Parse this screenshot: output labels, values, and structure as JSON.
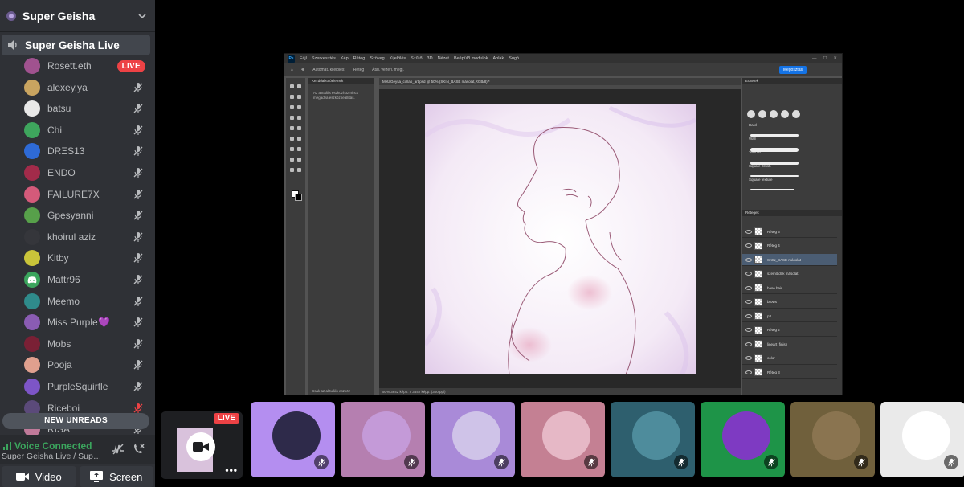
{
  "server": {
    "name": "Super Geisha"
  },
  "channel": {
    "name": "Super Geisha Live"
  },
  "users": [
    {
      "name": "Rosett.eth",
      "live": true,
      "color": "#a0528f"
    },
    {
      "name": "alexey.ya",
      "color": "#c9a460"
    },
    {
      "name": "batsu",
      "color": "#e8e8e8"
    },
    {
      "name": "Chi",
      "color": "#3ea55d"
    },
    {
      "name": "DRΞS13",
      "color": "#2e6ad6"
    },
    {
      "name": "ENDO",
      "color": "#a22b4a"
    },
    {
      "name": "FAILURE7X",
      "color": "#d45a7a"
    },
    {
      "name": "Gpesyanni",
      "color": "#57a04a"
    },
    {
      "name": "khoirul aziz",
      "color": "#35363b"
    },
    {
      "name": "Kitby",
      "color": "#c9c43a"
    },
    {
      "name": "Mattr96",
      "color": "#3ba55d",
      "discord": true
    },
    {
      "name": "Meemo",
      "color": "#2f8b8b"
    },
    {
      "name": "Miss Purple",
      "color": "#8a5cb3",
      "heart": "💜"
    },
    {
      "name": "Mobs",
      "color": "#7a2035"
    },
    {
      "name": "Pooja",
      "color": "#e0a08e"
    },
    {
      "name": "PurpleSquirtle",
      "color": "#7d55c7"
    },
    {
      "name": "Riceboi",
      "color": "#5b4a7a",
      "muted_red": true
    },
    {
      "name": "RISA",
      "color": "#c07a9a"
    }
  ],
  "new_unreads": "NEW UNREADS",
  "voice": {
    "status": "Voice Connected",
    "channel": "Super Geisha Live / Super Geisha"
  },
  "buttons": {
    "video": "Video",
    "screen": "Screen"
  },
  "stream": {
    "live_label": "LIVE"
  },
  "photoshop": {
    "logo": "Ps",
    "menu": [
      "Fájl",
      "Szerkesztés",
      "Kép",
      "Réteg",
      "Szöveg",
      "Kijelölés",
      "Szűrő",
      "3D",
      "Nézet",
      "Beépülő modulok",
      "Ablak",
      "Súgó"
    ],
    "options": [
      "Automat. kijelölés:",
      "Réteg",
      "Átal. vezérl. megj."
    ],
    "share": "Megosztás",
    "lib_tab": "Kezdőalkotóelemek",
    "lib_text": "Az aktuális eszközhöz nincs megadva eszközbeállítás.",
    "lib_bottom": "Csak az aktuális eszköz",
    "doc_tab": "MetaGeysa_collab_art.psd @ 50% (SKIN_BASE másolat,RGB/8) *",
    "status": "50%   3642 képp. x 3642 képp. (300 ppi)",
    "brushes_title": "Ecsetek",
    "brush_categories": [
      "Hard",
      "Wall",
      "Texture",
      "Square Brush",
      "Square texture"
    ],
    "layers_title": "Rétegek",
    "layers": [
      "Réteg 5",
      "Réteg 4",
      "SKIN_BASE másolat",
      "szemöldök másolat",
      "base hair",
      "brows",
      "p3",
      "Réteg 2",
      "lineart_finish",
      "color",
      "Réteg 3"
    ]
  },
  "participants": [
    {
      "bg": "#b48ef0",
      "avatar": "#2e2a4a"
    },
    {
      "bg": "#b57fb0",
      "avatar": "#c49ad8"
    },
    {
      "bg": "#a98ad8",
      "avatar": "#cfc3e8"
    },
    {
      "bg": "#c48093",
      "avatar": "#e6b8c6"
    },
    {
      "bg": "#2e5f6e",
      "avatar": "#4e8c9c"
    },
    {
      "bg": "#1e9448",
      "avatar": "#7e3ac2"
    },
    {
      "bg": "#70603c",
      "avatar": "#8a7450"
    },
    {
      "bg": "#eaeaea",
      "avatar": "#ffffff"
    }
  ]
}
